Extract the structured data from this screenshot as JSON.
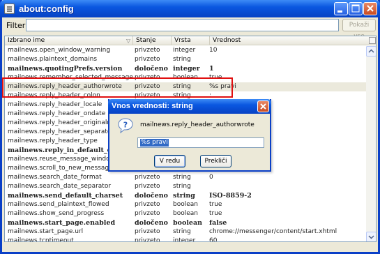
{
  "window": {
    "title": "about:config",
    "icon": "document-icon"
  },
  "filter": {
    "label": "Filter:",
    "value": "",
    "show_all_label": "Pokaži vse"
  },
  "columns": [
    "Izbrano ime",
    "Stanje",
    "Vrsta",
    "Vrednost"
  ],
  "rows": [
    {
      "name": "mailnews.open_window_warning",
      "state": "privzeto",
      "type": "integer",
      "value": "10",
      "bold": false
    },
    {
      "name": "mailnews.plaintext_domains",
      "state": "privzeto",
      "type": "string",
      "value": "",
      "bold": false
    },
    {
      "name": "mailnews.quotingPrefs.version",
      "state": "določeno",
      "type": "integer",
      "value": "1",
      "bold": true
    },
    {
      "name": "mailnews.remember_selected_message",
      "state": "privzeto",
      "type": "boolean",
      "value": "true",
      "bold": false
    },
    {
      "name": "mailnews.reply_header_authorwrote",
      "state": "privzeto",
      "type": "string",
      "value": "%s pravi",
      "bold": false
    },
    {
      "name": "mailnews.reply_header_colon",
      "state": "privzeto",
      "type": "string",
      "value": ":",
      "bold": false
    },
    {
      "name": "mailnews.reply_header_locale",
      "state": "",
      "type": "",
      "value": "",
      "bold": false
    },
    {
      "name": "mailnews.reply_header_ondate",
      "state": "",
      "type": "",
      "value": "",
      "bold": false
    },
    {
      "name": "mailnews.reply_header_originalmessage",
      "state": "",
      "type": "",
      "value": "",
      "bold": false
    },
    {
      "name": "mailnews.reply_header_separator",
      "state": "",
      "type": "",
      "value": "",
      "bold": false
    },
    {
      "name": "mailnews.reply_header_type",
      "state": "",
      "type": "",
      "value": "",
      "bold": false
    },
    {
      "name": "mailnews.reply_in_default_charset",
      "state": "",
      "type": "",
      "value": "",
      "bold": true
    },
    {
      "name": "mailnews.reuse_message_window",
      "state": "",
      "type": "",
      "value": "",
      "bold": false
    },
    {
      "name": "mailnews.scroll_to_new_message",
      "state": "",
      "type": "",
      "value": "",
      "bold": false
    },
    {
      "name": "mailnews.search_date_format",
      "state": "privzeto",
      "type": "string",
      "value": "0",
      "bold": false
    },
    {
      "name": "mailnews.search_date_separator",
      "state": "privzeto",
      "type": "string",
      "value": "",
      "bold": false
    },
    {
      "name": "mailnews.send_default_charset",
      "state": "določeno",
      "type": "string",
      "value": "ISO-8859-2",
      "bold": true
    },
    {
      "name": "mailnews.send_plaintext_flowed",
      "state": "privzeto",
      "type": "boolean",
      "value": "true",
      "bold": false
    },
    {
      "name": "mailnews.show_send_progress",
      "state": "privzeto",
      "type": "boolean",
      "value": "true",
      "bold": false
    },
    {
      "name": "mailnews.start_page.enabled",
      "state": "določeno",
      "type": "boolean",
      "value": "false",
      "bold": true
    },
    {
      "name": "mailnews.start_page.url",
      "state": "privzeto",
      "type": "string",
      "value": "chrome://messenger/content/start.xhtml",
      "bold": false
    },
    {
      "name": "mailnews.tcptimeout",
      "state": "privzeto",
      "type": "integer",
      "value": "60",
      "bold": false
    }
  ],
  "selected_row_index": 4,
  "dialog": {
    "title": "Vnos vrednosti: string",
    "message": "mailnews.reply_header_authorwrote",
    "input_value": "%s pravi",
    "ok_label": "V redu",
    "cancel_label": "Prekliči",
    "icon": "question-icon"
  },
  "colors": {
    "titlebar": "#0a57e0",
    "highlight_box": "#e01010",
    "selection": "#316ac5"
  }
}
